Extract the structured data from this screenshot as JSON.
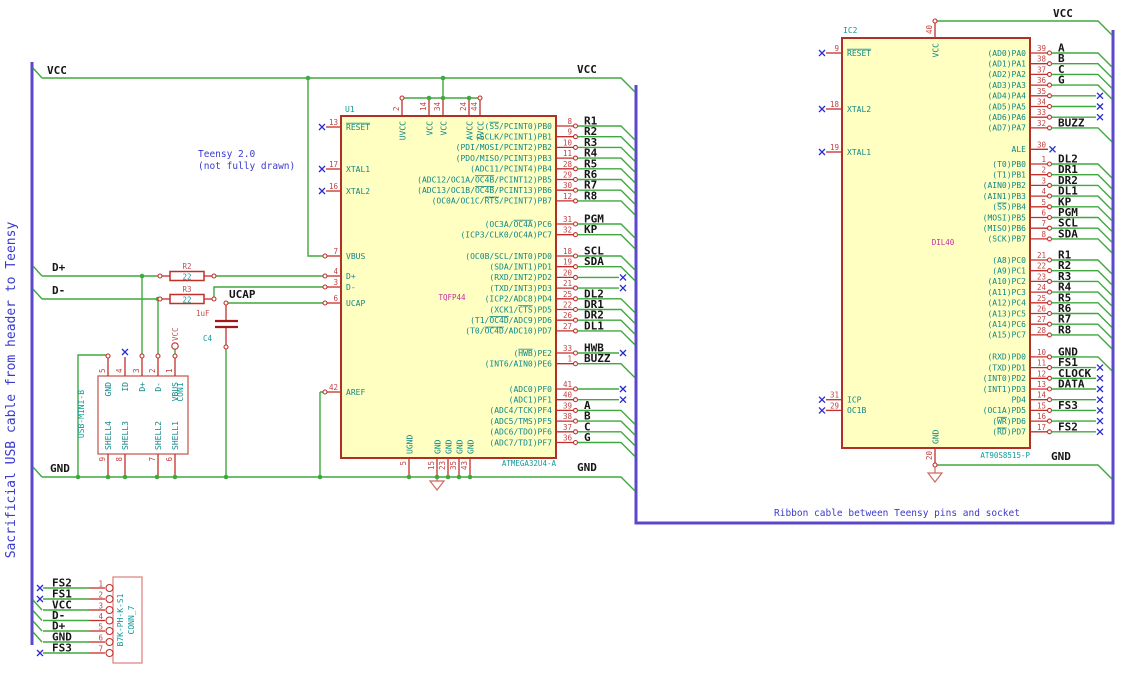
{
  "notes": {
    "left_vertical": "Sacrificial USB cable from header to Teensy",
    "teensy_line1": "Teensy 2.0",
    "teensy_line2": "(not fully drawn)",
    "ribbon": "Ribbon cable between Teensy pins and socket"
  },
  "wire_labels": {
    "vcc_top_left": "VCC",
    "vcc_mid": "VCC",
    "vcc_right": "VCC",
    "gnd_left": "GND",
    "gnd_mid": "GND",
    "gnd_right": "GND",
    "dplus": "D+",
    "dminus": "D-",
    "ucap": "UCAP"
  },
  "colors": {
    "wire_green": "#3FA93F",
    "bus_blue": "#5A48CC",
    "pin_red": "#C22F2A",
    "component_fill": "#FFFFC2",
    "component_border": "#B03028",
    "pin_name_teal": "#108888",
    "footprint_magenta": "#C22FA0",
    "note_blue": "#3A3ACD",
    "label_black": "#161616",
    "no_connect_blue": "#2A2AD0"
  },
  "components": {
    "u1": {
      "ref": "U1",
      "value": "ATMEGA32U4-A",
      "footprint": "TQFP44",
      "left_pins": [
        {
          "num": "13",
          "name": "~RESET~",
          "nc": true
        },
        {
          "num": "17",
          "name": "XTAL1",
          "nc": true
        },
        {
          "num": "16",
          "name": "XTAL2",
          "nc": true
        },
        {
          "num": "7",
          "name": "VBUS"
        },
        {
          "num": "4",
          "name": "D+"
        },
        {
          "num": "3",
          "name": "D-"
        },
        {
          "num": "6",
          "name": "UCAP"
        },
        {
          "num": "42",
          "name": "AREF"
        }
      ],
      "right_pins": [
        {
          "num": "8",
          "name": "(~SS~/PCINT0)PB0",
          "label": "R1",
          "term": "bus"
        },
        {
          "num": "9",
          "name": "(SCLK/PCINT1)PB1",
          "label": "R2",
          "term": "bus"
        },
        {
          "num": "10",
          "name": "(PDI/MOSI/PCINT2)PB2",
          "label": "R3",
          "term": "bus"
        },
        {
          "num": "11",
          "name": "(PDO/MISO/PCINT3)PB3",
          "label": "R4",
          "term": "bus"
        },
        {
          "num": "28",
          "name": "(ADC11/PCINT4)PB4",
          "label": "R5",
          "term": "bus"
        },
        {
          "num": "29",
          "name": "(ADC12/OC1A/~OC4B~/PCINT12)PB5",
          "label": "R6",
          "term": "bus"
        },
        {
          "num": "30",
          "name": "(ADC13/OC1B/~OC4B~/PCINT13)PB6",
          "label": "R7",
          "term": "bus"
        },
        {
          "num": "12",
          "name": "(OC0A/OC1C/~RTS~/PCINT7)PB7",
          "label": "R8",
          "term": "bus"
        },
        {
          "num": "31",
          "name": "(OC3A/~OC4A~)PC6",
          "label": "PGM",
          "term": "bus"
        },
        {
          "num": "32",
          "name": "(ICP3/CLK0/OC4A)PC7",
          "label": "KP",
          "term": "bus"
        },
        {
          "num": "18",
          "name": "(OC0B/SCL/INT0)PD0",
          "label": "SCL",
          "term": "bus"
        },
        {
          "num": "19",
          "name": "(SDA/INT1)PD1",
          "label": "SDA",
          "term": "bus"
        },
        {
          "num": "20",
          "name": "(RXD/INT2)PD2",
          "term": "nc"
        },
        {
          "num": "21",
          "name": "(TXD/INT3)PD3",
          "term": "nc"
        },
        {
          "num": "25",
          "name": "(ICP2/ADC8)PD4",
          "label": "DL2",
          "term": "bus"
        },
        {
          "num": "22",
          "name": "(XCK1/~CTS~)PD5",
          "label": "DR1",
          "term": "bus"
        },
        {
          "num": "26",
          "name": "(T1/~OC4D~/ADC9)PD6",
          "label": "DR2",
          "term": "bus"
        },
        {
          "num": "27",
          "name": "(T0/~OC4D~/ADC10)PD7",
          "label": "DL1",
          "term": "bus"
        },
        {
          "num": "33",
          "name": "(~HWB~)PE2",
          "label": "HWB",
          "term": "nc"
        },
        {
          "num": "1",
          "name": "(INT6/AIN0)PE6",
          "label": "BUZZ",
          "term": "bus"
        },
        {
          "num": "41",
          "name": "(ADC0)PF0",
          "term": "nc"
        },
        {
          "num": "40",
          "name": "(ADC1)PF1",
          "term": "nc"
        },
        {
          "num": "39",
          "name": "(ADC4/TCK)PF4",
          "label": "A",
          "term": "bus"
        },
        {
          "num": "38",
          "name": "(ADC5/TMS)PF5",
          "label": "B",
          "term": "bus"
        },
        {
          "num": "37",
          "name": "(ADC6/TDO)PF6",
          "label": "C",
          "term": "bus"
        },
        {
          "num": "36",
          "name": "(ADC7/TDI)PF7",
          "label": "G",
          "term": "bus"
        }
      ],
      "top_pins": [
        {
          "num": "2",
          "name": "UVCC"
        },
        {
          "num": "14",
          "name": "VCC"
        },
        {
          "num": "34",
          "name": "VCC"
        },
        {
          "num": "24",
          "name": "AVCC"
        },
        {
          "num": "44",
          "name": "AVCC"
        }
      ],
      "bottom_pins": [
        {
          "num": "5",
          "name": "UGND"
        },
        {
          "num": "15",
          "name": "GND"
        },
        {
          "num": "23",
          "name": "GND"
        },
        {
          "num": "35",
          "name": "GND"
        },
        {
          "num": "43",
          "name": "GND"
        }
      ]
    },
    "ic2": {
      "ref": "IC2",
      "value": "AT90S8515-P",
      "footprint": "DIL40",
      "left_pins": [
        {
          "num": "9",
          "name": "~RESET~",
          "nc": true
        },
        {
          "num": "18",
          "name": "XTAL2",
          "nc": true
        },
        {
          "num": "19",
          "name": "XTAL1",
          "nc": true
        },
        {
          "num": "31",
          "name": "ICP",
          "nc": true
        },
        {
          "num": "29",
          "name": "OC1B",
          "nc": true
        }
      ],
      "right_pins": [
        {
          "num": "39",
          "name": "(AD0)PA0",
          "label": "A",
          "term": "bus"
        },
        {
          "num": "38",
          "name": "(AD1)PA1",
          "label": "B",
          "term": "bus"
        },
        {
          "num": "37",
          "name": "(AD2)PA2",
          "label": "C",
          "term": "bus"
        },
        {
          "num": "36",
          "name": "(AD3)PA3",
          "label": "G",
          "term": "bus"
        },
        {
          "num": "35",
          "name": "(AD4)PA4",
          "term": "nc"
        },
        {
          "num": "34",
          "name": "(AD5)PA5",
          "term": "nc"
        },
        {
          "num": "33",
          "name": "(AD6)PA6",
          "term": "nc"
        },
        {
          "num": "32",
          "name": "(AD7)PA7",
          "label": "BUZZ",
          "term": "bus"
        },
        {
          "num": "30",
          "name": "ALE",
          "term": "ncpin"
        },
        {
          "num": "1",
          "name": "(T0)PB0",
          "label": "DL2",
          "term": "bus"
        },
        {
          "num": "2",
          "name": "(T1)PB1",
          "label": "DR1",
          "term": "bus"
        },
        {
          "num": "3",
          "name": "(AIN0)PB2",
          "label": "DR2",
          "term": "bus"
        },
        {
          "num": "4",
          "name": "(AIN1)PB3",
          "label": "DL1",
          "term": "bus"
        },
        {
          "num": "5",
          "name": "(~SS~)PB4",
          "label": "KP",
          "term": "bus"
        },
        {
          "num": "6",
          "name": "(MOSI)PB5",
          "label": "PGM",
          "term": "bus"
        },
        {
          "num": "7",
          "name": "(MISO)PB6",
          "label": "SCL",
          "term": "bus"
        },
        {
          "num": "8",
          "name": "(SCK)PB7",
          "label": "SDA",
          "term": "bus"
        },
        {
          "num": "21",
          "name": "(A8)PC0",
          "label": "R1",
          "term": "bus"
        },
        {
          "num": "22",
          "name": "(A9)PC1",
          "label": "R2",
          "term": "bus"
        },
        {
          "num": "23",
          "name": "(A10)PC2",
          "label": "R3",
          "term": "bus"
        },
        {
          "num": "24",
          "name": "(A11)PC3",
          "label": "R4",
          "term": "bus"
        },
        {
          "num": "25",
          "name": "(A12)PC4",
          "label": "R5",
          "term": "bus"
        },
        {
          "num": "26",
          "name": "(A13)PC5",
          "label": "R6",
          "term": "bus"
        },
        {
          "num": "27",
          "name": "(A14)PC6",
          "label": "R7",
          "term": "bus"
        },
        {
          "num": "28",
          "name": "(A15)PC7",
          "label": "R8",
          "term": "bus"
        },
        {
          "num": "10",
          "name": "(RXD)PD0",
          "label": "GND",
          "term": "bus"
        },
        {
          "num": "11",
          "name": "(TXD)PD1",
          "label": "FS1",
          "term": "nc"
        },
        {
          "num": "12",
          "name": "(INT0)PD2",
          "label": "CLOCK",
          "term": "nc"
        },
        {
          "num": "13",
          "name": "(INT1)PD3",
          "label": "DATA",
          "term": "nc"
        },
        {
          "num": "14",
          "name": "PD4",
          "term": "nc"
        },
        {
          "num": "15",
          "name": "(OC1A)PD5",
          "label": "FS3",
          "term": "nc"
        },
        {
          "num": "16",
          "name": "(~WR~)PD6",
          "term": "nc"
        },
        {
          "num": "17",
          "name": "(~RD~)PD7",
          "label": "FS2",
          "term": "nc"
        }
      ],
      "top_pins": [
        {
          "num": "40",
          "name": "VCC"
        }
      ],
      "bottom_pins": [
        {
          "num": "20",
          "name": "GND"
        }
      ]
    },
    "con1": {
      "ref": "CON1",
      "value": "USB-MINI-B",
      "top_pins": [
        {
          "num": "5",
          "name": "GND"
        },
        {
          "num": "4",
          "name": "ID"
        },
        {
          "num": "3",
          "name": "D+"
        },
        {
          "num": "2",
          "name": "D-"
        },
        {
          "num": "1",
          "name": "VBUS"
        }
      ],
      "bottom_pins": [
        {
          "num": "9",
          "name": "SHELL4"
        },
        {
          "num": "8",
          "name": "SHELL3"
        },
        {
          "num": "7",
          "name": "SHELL2"
        },
        {
          "num": "6",
          "name": "SHELL1"
        }
      ]
    },
    "conn7": {
      "ref": "CONN_7",
      "value": "B7K-PH-K-S1",
      "pins": [
        {
          "num": "1",
          "label": "FS2",
          "term": "nc"
        },
        {
          "num": "2",
          "label": "FS1",
          "term": "nc"
        },
        {
          "num": "3",
          "label": "VCC",
          "term": "bus"
        },
        {
          "num": "4",
          "label": "D-",
          "term": "bus"
        },
        {
          "num": "5",
          "label": "D+",
          "term": "bus"
        },
        {
          "num": "6",
          "label": "GND",
          "term": "bus"
        },
        {
          "num": "7",
          "label": "FS3",
          "term": "nc"
        }
      ]
    },
    "r2": {
      "ref": "R2",
      "value": "22"
    },
    "r3": {
      "ref": "R3",
      "value": "22"
    },
    "c4": {
      "ref": "C4",
      "value": "1uF"
    },
    "vcc_symbol": {
      "label": "VCC"
    }
  }
}
